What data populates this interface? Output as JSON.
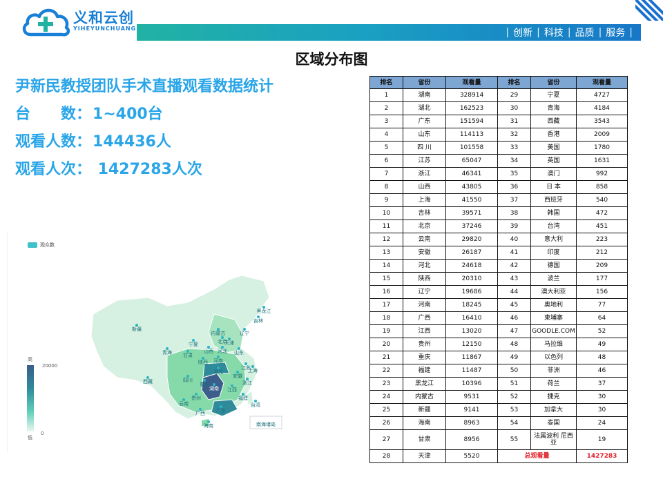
{
  "brand": {
    "name_cn": "义和云创",
    "name_en": "YIHEYUNCHUANG"
  },
  "header": {
    "nav_items": [
      {
        "label": "创新"
      },
      {
        "label": "科技"
      },
      {
        "label": "品质"
      },
      {
        "label": "服务"
      }
    ]
  },
  "page_title": "区域分布图",
  "stats": {
    "title": "尹新民教授团队手术直播观看数据统计",
    "devices_label": "台　　数：",
    "devices_value": "1~400台",
    "viewers_label": "观看人数：",
    "viewers_value": "144436人",
    "views_label": "观看人次：",
    "views_value": " 1427283人次"
  },
  "map": {
    "legend_label": "观众数",
    "visual_map": {
      "high_label": "高",
      "low_label": "低",
      "max": "20000",
      "min": "0"
    },
    "colors": {
      "high": "#3b5e8a",
      "mid": "#5fcfb9",
      "low": "#e8f7f0",
      "base": "#cfeee0",
      "point": "#29b5c5"
    },
    "province_labels": [
      "黑龙江",
      "吉林",
      "辽宁",
      "内蒙古",
      "北京",
      "天津",
      "河北",
      "山西",
      "山东",
      "宁夏",
      "甘肃",
      "青海",
      "新疆",
      "西藏",
      "陕西",
      "河南",
      "江苏",
      "安徽",
      "上海",
      "湖北",
      "浙江",
      "四川",
      "重庆",
      "湖南",
      "江西",
      "福建",
      "贵州",
      "云南",
      "广西",
      "广东",
      "台湾",
      "海南",
      "南海诸岛"
    ]
  },
  "chart_data": {
    "type": "table",
    "columns": [
      "排名",
      "省份",
      "观看量",
      "排名",
      "省份",
      "观看量"
    ],
    "rows": [
      [
        {
          "rank": "1",
          "region": "湖南",
          "views": "328914"
        },
        {
          "rank": "29",
          "region": "宁夏",
          "views": "4727"
        }
      ],
      [
        {
          "rank": "2",
          "region": "湖北",
          "views": "162523"
        },
        {
          "rank": "30",
          "region": "青海",
          "views": "4184"
        }
      ],
      [
        {
          "rank": "3",
          "region": "广东",
          "views": "151594"
        },
        {
          "rank": "31",
          "region": "西藏",
          "views": "3543"
        }
      ],
      [
        {
          "rank": "4",
          "region": "山东",
          "views": "114113"
        },
        {
          "rank": "32",
          "region": "香港",
          "views": "2009"
        }
      ],
      [
        {
          "rank": "5",
          "region": "四 川",
          "views": "101558"
        },
        {
          "rank": "33",
          "region": "美国",
          "views": "1780"
        }
      ],
      [
        {
          "rank": "6",
          "region": "江苏",
          "views": "65047"
        },
        {
          "rank": "34",
          "region": "英国",
          "views": "1631"
        }
      ],
      [
        {
          "rank": "7",
          "region": "浙江",
          "views": "46341"
        },
        {
          "rank": "35",
          "region": "澳门",
          "views": "992"
        }
      ],
      [
        {
          "rank": "8",
          "region": "山西",
          "views": "43805"
        },
        {
          "rank": "36",
          "region": "日 本",
          "views": "858"
        }
      ],
      [
        {
          "rank": "9",
          "region": "上海",
          "views": "41550"
        },
        {
          "rank": "37",
          "region": "西班牙",
          "views": "540"
        }
      ],
      [
        {
          "rank": "10",
          "region": "吉林",
          "views": "39571"
        },
        {
          "rank": "38",
          "region": "韩国",
          "views": "472"
        }
      ],
      [
        {
          "rank": "11",
          "region": "北京",
          "views": "37246"
        },
        {
          "rank": "39",
          "region": "台湾",
          "views": "451"
        }
      ],
      [
        {
          "rank": "12",
          "region": "云南",
          "views": "29820"
        },
        {
          "rank": "40",
          "region": "意大利",
          "views": "223"
        }
      ],
      [
        {
          "rank": "13",
          "region": "安徽",
          "views": "26187"
        },
        {
          "rank": "41",
          "region": "印度",
          "views": "212"
        }
      ],
      [
        {
          "rank": "14",
          "region": "河北",
          "views": "24618"
        },
        {
          "rank": "42",
          "region": "德国",
          "views": "209"
        }
      ],
      [
        {
          "rank": "15",
          "region": "陕西",
          "views": "20310"
        },
        {
          "rank": "43",
          "region": "波兰",
          "views": "177"
        }
      ],
      [
        {
          "rank": "16",
          "region": "辽宁",
          "views": "19686"
        },
        {
          "rank": "44",
          "region": "澳大利亚",
          "views": "156"
        }
      ],
      [
        {
          "rank": "17",
          "region": "河南",
          "views": "18245"
        },
        {
          "rank": "45",
          "region": "奥地利",
          "views": "77"
        }
      ],
      [
        {
          "rank": "18",
          "region": "广西",
          "views": "16410"
        },
        {
          "rank": "46",
          "region": "柬埔寨",
          "views": "64"
        }
      ],
      [
        {
          "rank": "19",
          "region": "江西",
          "views": "13020"
        },
        {
          "rank": "47",
          "region": "GOODLE.COM",
          "views": "52"
        }
      ],
      [
        {
          "rank": "20",
          "region": "贵州",
          "views": "12150"
        },
        {
          "rank": "48",
          "region": "马拉维",
          "views": "49"
        }
      ],
      [
        {
          "rank": "21",
          "region": "重庆",
          "views": "11867"
        },
        {
          "rank": "49",
          "region": "以色列",
          "views": "48"
        }
      ],
      [
        {
          "rank": "22",
          "region": "福建",
          "views": "11487"
        },
        {
          "rank": "50",
          "region": "非洲",
          "views": "46"
        }
      ],
      [
        {
          "rank": "23",
          "region": "黑龙江",
          "views": "10396"
        },
        {
          "rank": "51",
          "region": "荷兰",
          "views": "37"
        }
      ],
      [
        {
          "rank": "24",
          "region": "内蒙古",
          "views": "9531"
        },
        {
          "rank": "52",
          "region": "捷克",
          "views": "30"
        }
      ],
      [
        {
          "rank": "25",
          "region": "新疆",
          "views": "9141"
        },
        {
          "rank": "53",
          "region": "加拿大",
          "views": "30"
        }
      ],
      [
        {
          "rank": "26",
          "region": "海南",
          "views": "8963"
        },
        {
          "rank": "54",
          "region": "泰国",
          "views": "24"
        }
      ],
      [
        {
          "rank": "27",
          "region": "甘肃",
          "views": "8956"
        },
        {
          "rank": "55",
          "region": "法属波利 尼西亚",
          "views": "19"
        }
      ],
      [
        {
          "rank": "28",
          "region": "天津",
          "views": "5520"
        },
        {
          "rank": "",
          "region": "总观看量",
          "views": "1427283"
        }
      ]
    ]
  }
}
